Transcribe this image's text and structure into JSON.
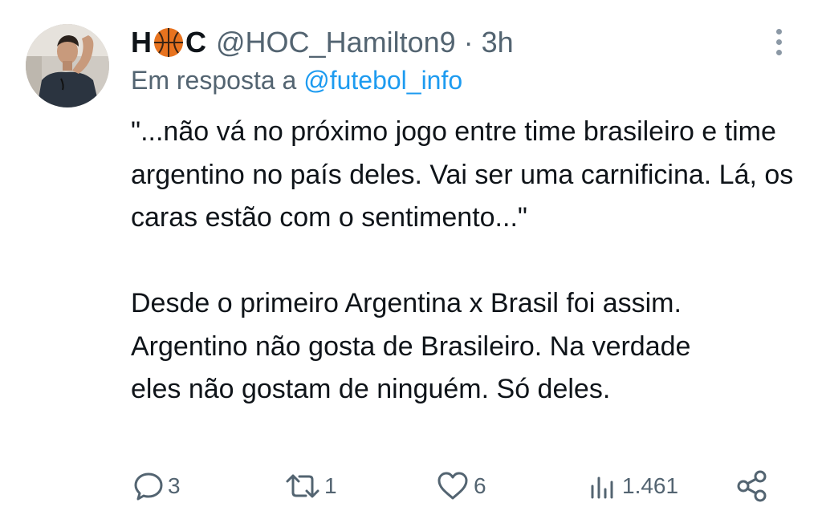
{
  "tweet": {
    "author_name_left": "H",
    "author_name_right": "C",
    "author_name_emoji": "basketball-icon",
    "handle": "@HOC_Hamilton9",
    "separator": "·",
    "time": "3h",
    "reply_prefix": "Em resposta a",
    "reply_mention": "@futebol_info",
    "body_paragraph_1": "\"...não vá no próximo jogo entre time brasileiro e time argentino no país deles. Vai ser uma carnificina. Lá, os caras estão com o sentimento...\"",
    "body_paragraph_2_lines": [
      "Desde o primeiro Argentina x Brasil foi assim.",
      "Argentino não gosta de Brasileiro. Na verdade",
      "eles não gostam de ninguém. Só deles."
    ],
    "actions": {
      "reply_count": "3",
      "retweet_count": "1",
      "like_count": "6",
      "views_count": "1.461"
    }
  },
  "colors": {
    "text_primary": "#0f1419",
    "text_secondary": "#536471",
    "link": "#1d9bf0",
    "basketball": "#e8731f"
  },
  "icons": {
    "more": "more-vertical-icon",
    "reply": "reply-icon",
    "retweet": "retweet-icon",
    "like": "heart-icon",
    "views": "views-icon",
    "share": "share-icon"
  }
}
